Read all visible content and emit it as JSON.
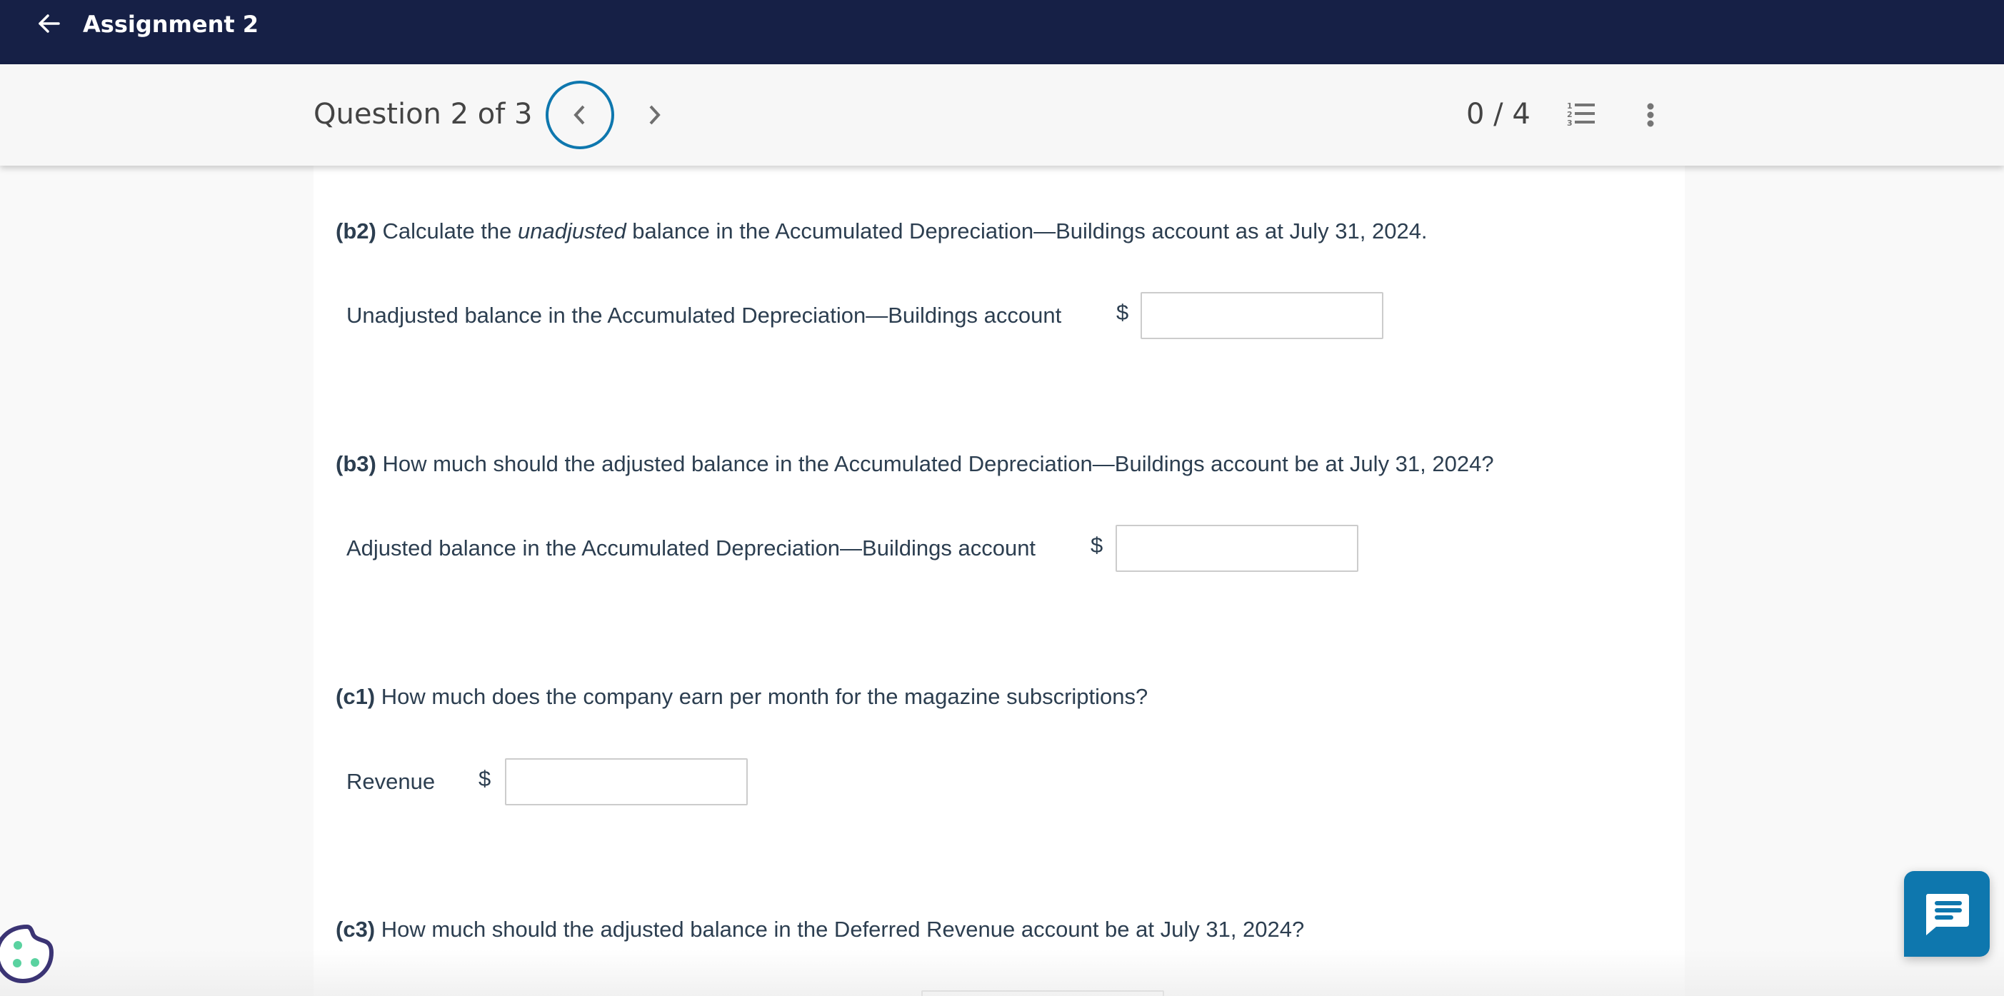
{
  "topbar": {
    "back_icon": "arrow-left-icon",
    "title": "Assignment 2",
    "background": "#162046"
  },
  "subheader": {
    "question_counter": "Question 2 of 3",
    "prev_icon": "chevron-left-icon",
    "next_icon": "chevron-right-icon",
    "score": "0 / 4",
    "list_icon": "numbered-list-icon",
    "more_icon": "more-vertical-icon",
    "accent": "#0e77ae"
  },
  "questions": [
    {
      "tag": "(b2)",
      "text_before": " Calculate the ",
      "emphasis": "unadjusted",
      "text_after": " balance in the Accumulated Depreciation—Buildings account as at July 31, 2024.",
      "field_label": "Unadjusted balance in the Accumulated Depreciation—Buildings account",
      "currency": "$",
      "value": "",
      "placeholder": ""
    },
    {
      "tag": "(b3)",
      "text": " How much should the adjusted balance in the Accumulated Depreciation—Buildings account be at July 31, 2024?",
      "field_label": "Adjusted balance in the Accumulated Depreciation—Buildings account",
      "currency": "$",
      "value": "",
      "placeholder": ""
    },
    {
      "tag": "(c1)",
      "text": " How much does the company earn per month for the magazine subscriptions?",
      "field_label": "Revenue",
      "currency": "$",
      "value": "",
      "placeholder": ""
    },
    {
      "tag": "(c3)",
      "text": " How much should the adjusted balance in the Deferred Revenue account be at July 31, 2024?",
      "value": "",
      "placeholder": ""
    }
  ],
  "widgets": {
    "cookie_icon": "cookie-icon",
    "chat_icon": "chat-message-icon",
    "chat_color": "#0e77ae"
  }
}
